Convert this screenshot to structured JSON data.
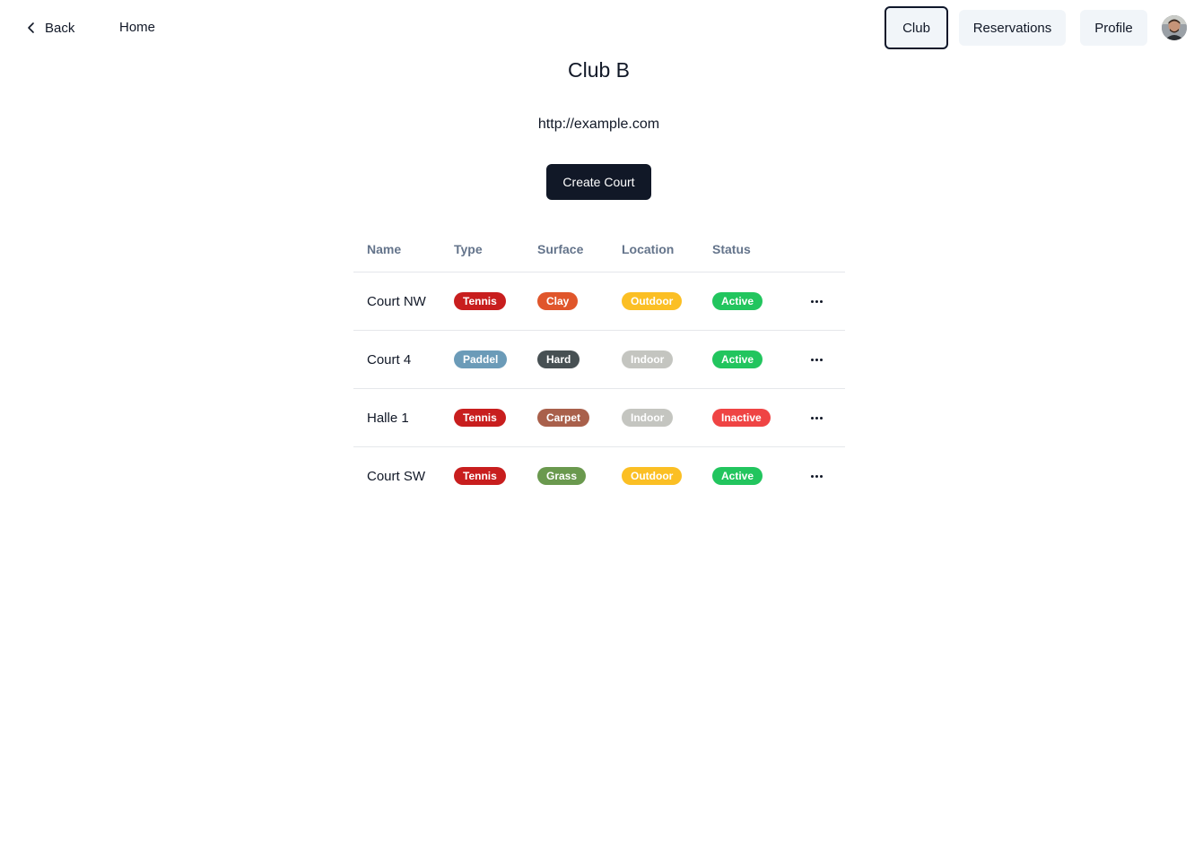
{
  "nav": {
    "back_label": "Back",
    "home_label": "Home",
    "club_label": "Club",
    "reservations_label": "Reservations",
    "profile_label": "Profile"
  },
  "club": {
    "name": "Club B",
    "website": "http://example.com",
    "create_label": "Create Court"
  },
  "table": {
    "headers": {
      "name": "Name",
      "type": "Type",
      "surface": "Surface",
      "location": "Location",
      "status": "Status"
    },
    "rows": [
      {
        "name": "Court NW",
        "type": {
          "label": "Tennis",
          "color": "#c81e1e"
        },
        "surface": {
          "label": "Clay",
          "color": "#e0562b"
        },
        "location": {
          "label": "Outdoor",
          "color": "#fbbf24"
        },
        "status": {
          "label": "Active",
          "color": "#22c55e"
        }
      },
      {
        "name": "Court 4",
        "type": {
          "label": "Paddel",
          "color": "#6b9bb8"
        },
        "surface": {
          "label": "Hard",
          "color": "#475053"
        },
        "location": {
          "label": "Indoor",
          "color": "#c4c5c0"
        },
        "status": {
          "label": "Active",
          "color": "#22c55e"
        }
      },
      {
        "name": "Halle 1",
        "type": {
          "label": "Tennis",
          "color": "#c81e1e"
        },
        "surface": {
          "label": "Carpet",
          "color": "#a9604b"
        },
        "location": {
          "label": "Indoor",
          "color": "#c4c5c0"
        },
        "status": {
          "label": "Inactive",
          "color": "#ef4444"
        }
      },
      {
        "name": "Court SW",
        "type": {
          "label": "Tennis",
          "color": "#c81e1e"
        },
        "surface": {
          "label": "Grass",
          "color": "#6a994e"
        },
        "location": {
          "label": "Outdoor",
          "color": "#fbbf24"
        },
        "status": {
          "label": "Active",
          "color": "#22c55e"
        }
      }
    ]
  }
}
